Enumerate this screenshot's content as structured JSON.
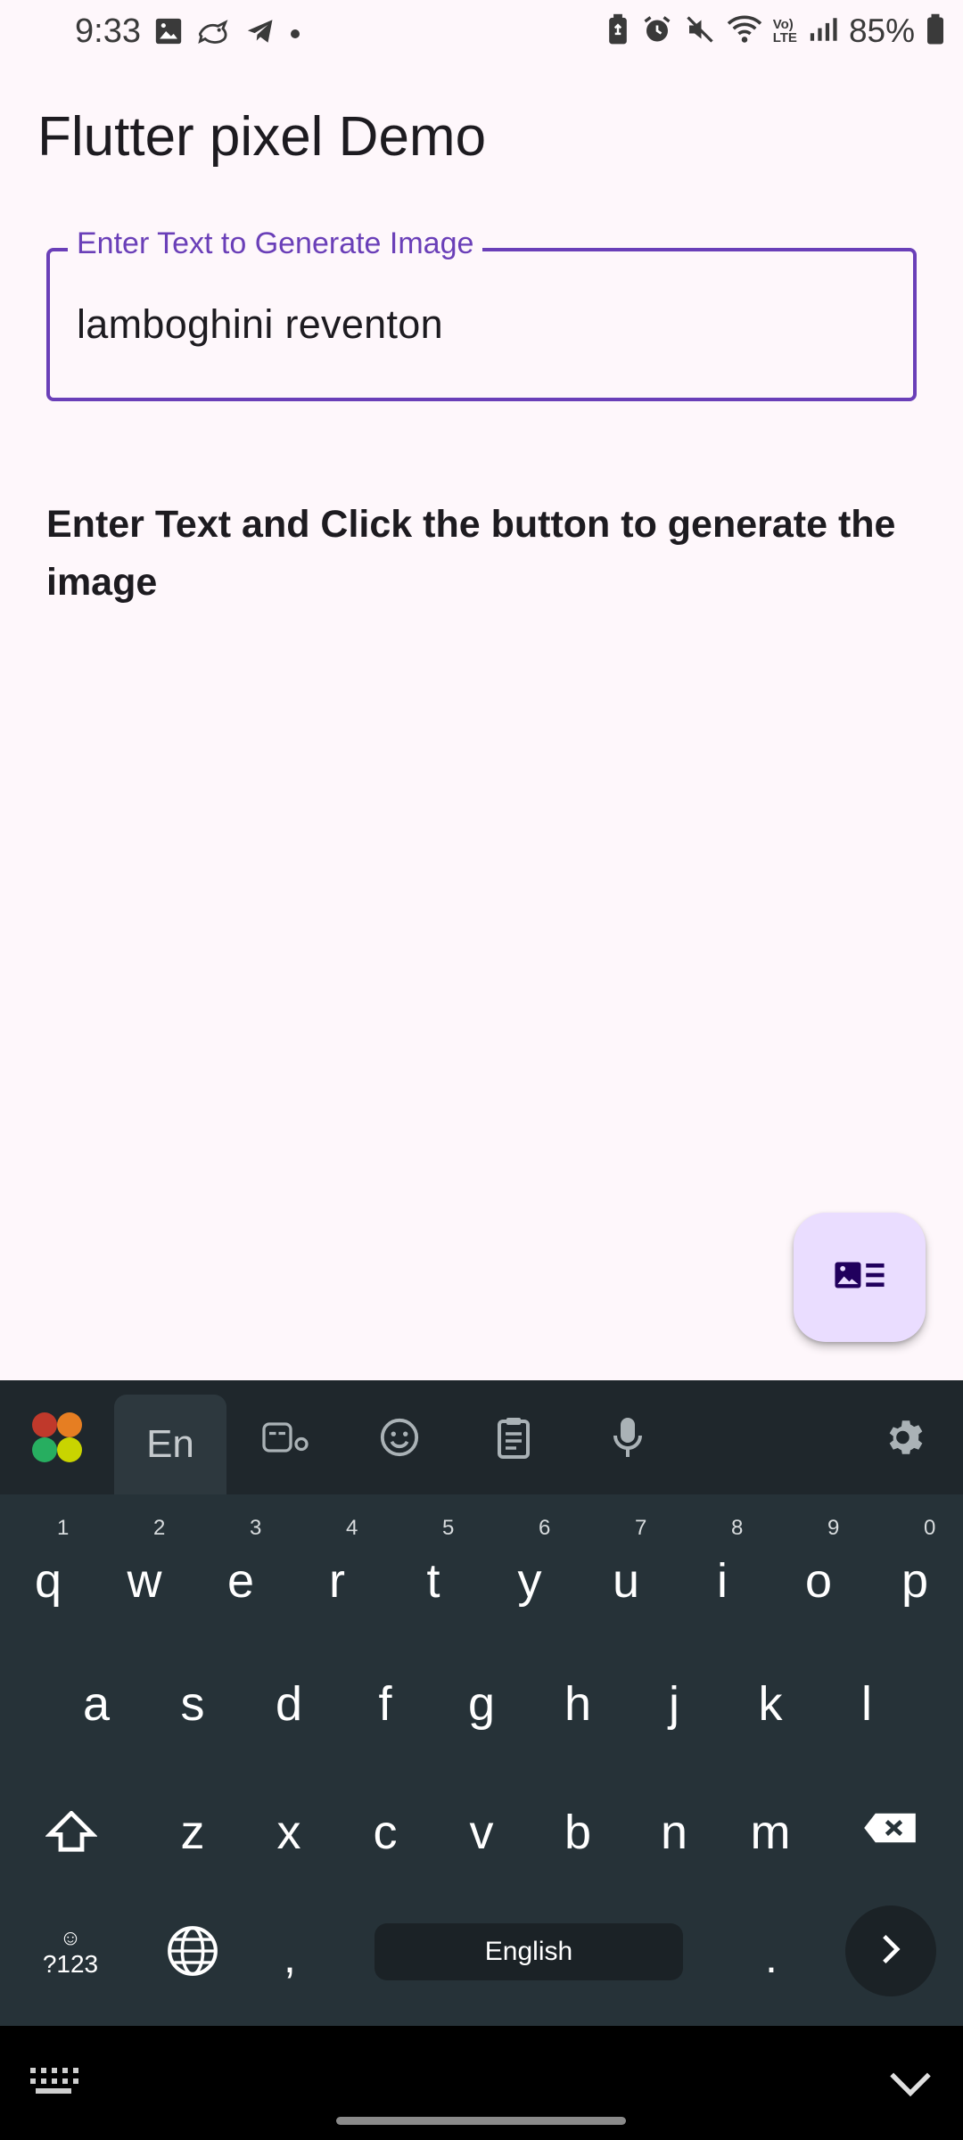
{
  "status_bar": {
    "time": "9:33",
    "battery": "85%",
    "left_icons": [
      "gallery-icon",
      "bird-icon",
      "telegram-icon",
      "dot-icon"
    ],
    "right_icons": [
      "battery-saver-icon",
      "alarm-icon",
      "mute-icon",
      "wifi-icon",
      "volte-icon",
      "signal-icon",
      "battery-icon"
    ],
    "volte_line1": "Vo)",
    "volte_line2": "LTE"
  },
  "app": {
    "title": "Flutter pixel Demo",
    "accent_color": "#6a3fb8",
    "fab_color": "#eaddff"
  },
  "text_field": {
    "label": "Enter Text to Generate Image",
    "value": "lamboghini reventon"
  },
  "instruction": "Enter Text and Click the button to generate the image",
  "fab": {
    "icon": "image-list-icon"
  },
  "keyboard": {
    "toolbar": {
      "language_tab": "En",
      "icons": [
        "app-logo-icon",
        "sticker-icon",
        "emoji-icon",
        "clipboard-icon",
        "mic-icon",
        "settings-icon"
      ]
    },
    "row1": [
      {
        "key": "q",
        "hint": "1"
      },
      {
        "key": "w",
        "hint": "2"
      },
      {
        "key": "e",
        "hint": "3"
      },
      {
        "key": "r",
        "hint": "4"
      },
      {
        "key": "t",
        "hint": "5"
      },
      {
        "key": "y",
        "hint": "6"
      },
      {
        "key": "u",
        "hint": "7"
      },
      {
        "key": "i",
        "hint": "8"
      },
      {
        "key": "o",
        "hint": "9"
      },
      {
        "key": "p",
        "hint": "0"
      }
    ],
    "row2": [
      "a",
      "s",
      "d",
      "f",
      "g",
      "h",
      "j",
      "k",
      "l"
    ],
    "row3": [
      "z",
      "x",
      "c",
      "v",
      "b",
      "n",
      "m"
    ],
    "symbols_key": "?123",
    "comma_key": ",",
    "space_label": "English",
    "period_key": ".",
    "background": "#263238"
  },
  "nav_bar": {
    "icons": [
      "keyboard-switch-icon",
      "hide-keyboard-icon"
    ]
  }
}
